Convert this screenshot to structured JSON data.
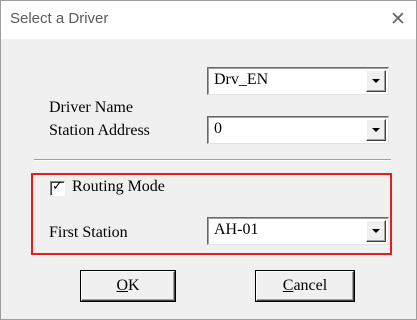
{
  "window": {
    "title": "Select a Driver",
    "close_glyph": "✕"
  },
  "driver": {
    "label": "Driver Name",
    "value": "Drv_EN"
  },
  "station": {
    "label": "Station Address",
    "value": "0"
  },
  "routing": {
    "checkbox_label": "Routing Mode",
    "checked": true,
    "check_glyph": "✓"
  },
  "first_station": {
    "label": "First Station",
    "value": "AH-01"
  },
  "buttons": {
    "ok_mnemonic": "O",
    "ok_rest": "K",
    "cancel_mnemonic": "C",
    "cancel_rest": "ancel"
  },
  "colors": {
    "highlight_box": "#e02020"
  }
}
